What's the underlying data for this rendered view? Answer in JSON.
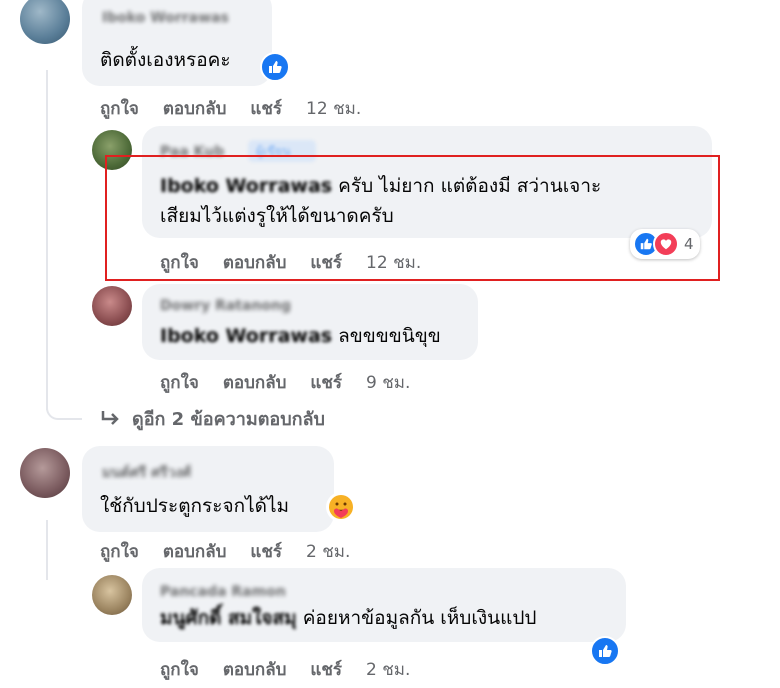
{
  "colors": {
    "accent": "#1877f2",
    "highlight": "#e02020",
    "love": "#f33e58",
    "care": "#f7b125"
  },
  "comments": [
    {
      "author": "Iboko Worrawas",
      "text": "ติดตั้งเองหรอคะ",
      "reaction": "like-icon",
      "actions": {
        "like": "ถูกใจ",
        "reply": "ตอบกลับ",
        "share": "แชร์",
        "time": "12 ชม."
      }
    },
    {
      "author": "Paa Kub",
      "badge": "ผู้เขียน",
      "mention": "Iboko Worrawas",
      "text_line1": " ครับ ไม่ยาก แต่ต้องมี สว่านเจาะ",
      "text_line2": "เสียมไว้แต่งรูให้ได้ขนาดครับ",
      "reaction_count": "4",
      "reactions": [
        "like-icon",
        "love-icon"
      ],
      "actions": {
        "like": "ถูกใจ",
        "reply": "ตอบกลับ",
        "share": "แชร์",
        "time": "12 ชม."
      }
    },
    {
      "author": "Dowry Ratanong",
      "mention": "Iboko Worrawas",
      "text": " ลขขขขนิขุข",
      "actions": {
        "like": "ถูกใจ",
        "reply": "ตอบกลับ",
        "share": "แชร์",
        "time": "9 ชม."
      }
    },
    {
      "more_replies": "ดูอีก 2 ข้อความตอบกลับ"
    },
    {
      "author": "มนต์ศรี ศรีวงศ์",
      "text": "ใช้กับประตูกระจกได้ไม",
      "reaction": "care-icon",
      "actions": {
        "like": "ถูกใจ",
        "reply": "ตอบกลับ",
        "share": "แชร์",
        "time": "2 ชม."
      }
    },
    {
      "author": "Pancada Ramon",
      "mention": "มนูศักดิ์ สมใจสมุ",
      "text": " ค่อยหาข้อมูลกัน เห็บเงินแปป",
      "reaction": "like-icon",
      "actions": {
        "like": "ถูกใจ",
        "reply": "ตอบกลับ",
        "share": "แชร์",
        "time": "2 ชม."
      }
    }
  ]
}
